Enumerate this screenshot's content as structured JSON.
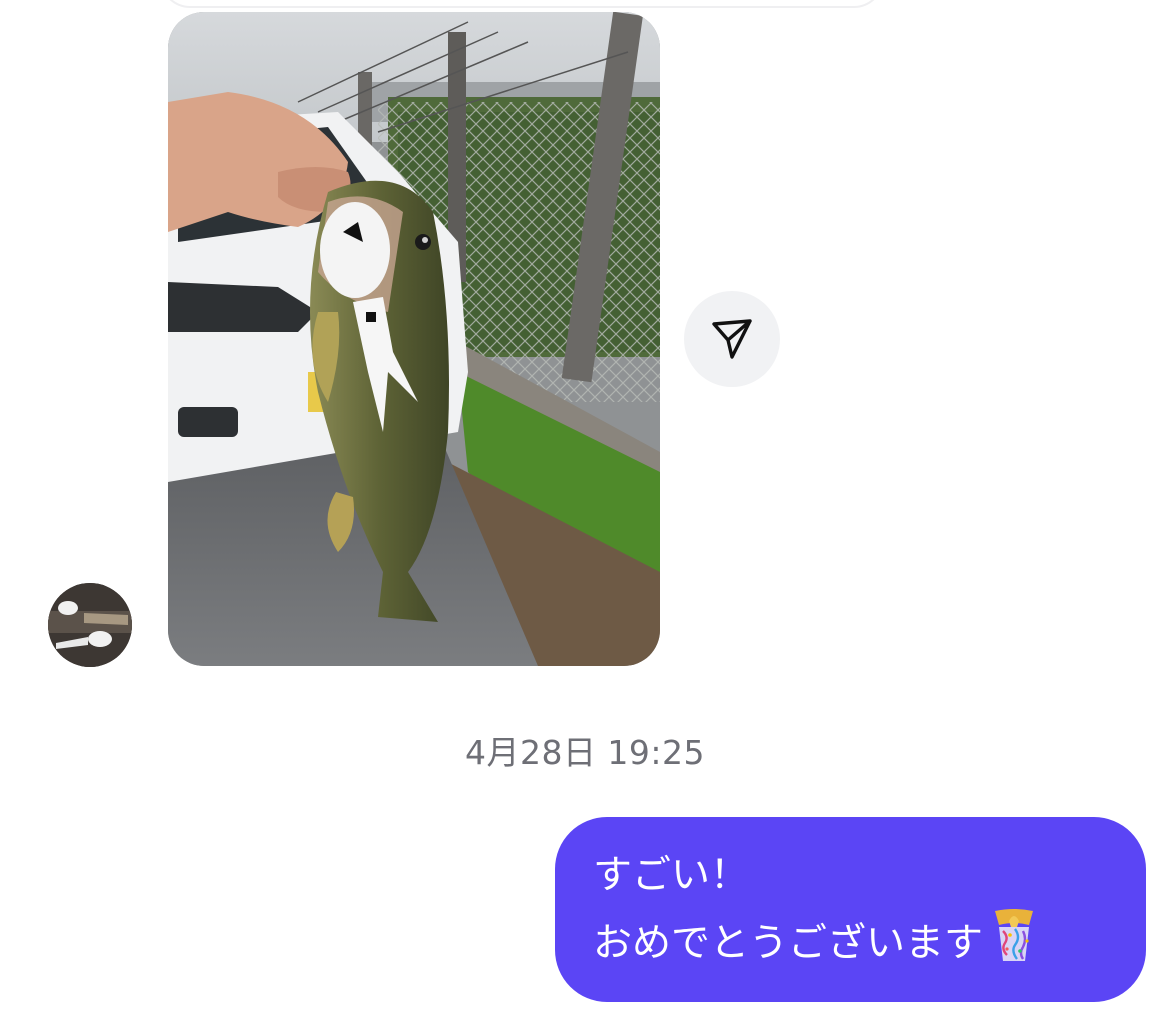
{
  "conversation": {
    "incoming_photo": {
      "description_icon": "photo-icon"
    },
    "share_button": {
      "icon": "send-icon"
    },
    "timestamp": "4月28日 19:25",
    "outgoing_message": {
      "lines": [
        "すごい！",
        "おめでとうございます"
      ],
      "emoji_icon": "party-popper-icon"
    }
  },
  "colors": {
    "bubble": "#5b45f5",
    "timestamp": "#6e6f76",
    "share_button_bg": "#f1f2f4"
  }
}
